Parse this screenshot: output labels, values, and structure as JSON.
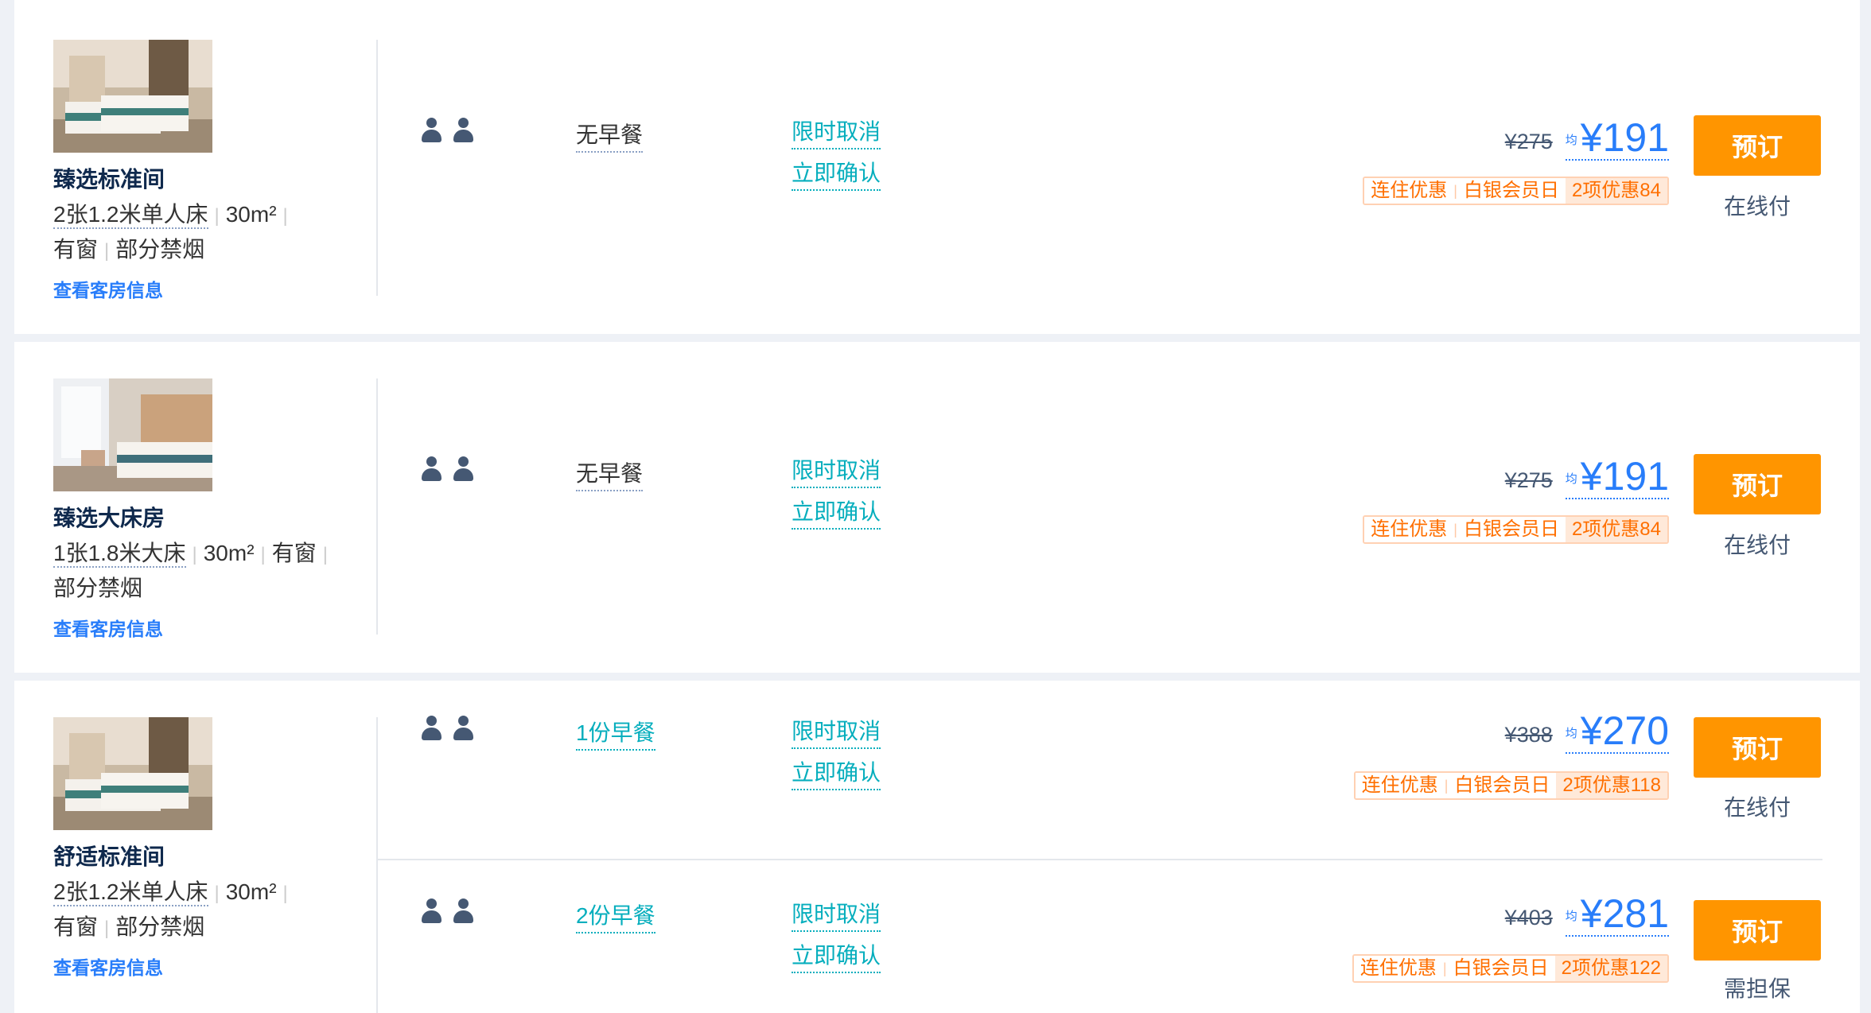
{
  "rooms": [
    {
      "name": "臻选标准间",
      "bed": "2张1.2米单人床",
      "area": "30m²",
      "window": "有窗",
      "smoking": "部分禁烟",
      "view_link": "查看客房信息",
      "offers": [
        {
          "meal": "无早餐",
          "cancel": "限时取消",
          "confirm": "立即确认",
          "original_price": "¥275",
          "avg_label": "均",
          "price": "¥191",
          "promos": [
            "连住优惠",
            "白银会员日"
          ],
          "promo_total": "2项优惠84",
          "book_label": "预订",
          "pay_type": "在线付"
        }
      ]
    },
    {
      "name": "臻选大床房",
      "bed": "1张1.8米大床",
      "area": "30m²",
      "window": "有窗",
      "smoking": "部分禁烟",
      "view_link": "查看客房信息",
      "offers": [
        {
          "meal": "无早餐",
          "cancel": "限时取消",
          "confirm": "立即确认",
          "original_price": "¥275",
          "avg_label": "均",
          "price": "¥191",
          "promos": [
            "连住优惠",
            "白银会员日"
          ],
          "promo_total": "2项优惠84",
          "book_label": "预订",
          "pay_type": "在线付"
        }
      ]
    },
    {
      "name": "舒适标准间",
      "bed": "2张1.2米单人床",
      "area": "30m²",
      "window": "有窗",
      "smoking": "部分禁烟",
      "view_link": "查看客房信息",
      "offers": [
        {
          "meal": "1份早餐",
          "cancel": "限时取消",
          "confirm": "立即确认",
          "original_price": "¥388",
          "avg_label": "均",
          "price": "¥270",
          "promos": [
            "连住优惠",
            "白银会员日"
          ],
          "promo_total": "2项优惠118",
          "book_label": "预订",
          "pay_type": "在线付"
        },
        {
          "meal": "2份早餐",
          "cancel": "限时取消",
          "confirm": "立即确认",
          "original_price": "¥403",
          "avg_label": "均",
          "price": "¥281",
          "promos": [
            "连住优惠",
            "白银会员日"
          ],
          "promo_total": "2项优惠122",
          "book_label": "预订",
          "pay_type": "需担保"
        }
      ]
    }
  ],
  "colors": {
    "accent_blue": "#287dfa",
    "teal": "#06aebd",
    "book_orange": "#ff9500",
    "promo_orange": "#ff6f00"
  }
}
